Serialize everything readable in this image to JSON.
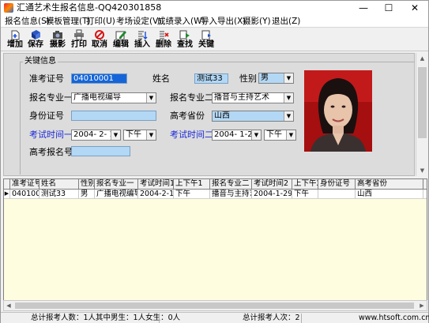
{
  "window": {
    "title": "汇通艺术生报名信息-QQ420301858",
    "minimize": "—",
    "maximize": "☐",
    "close": "✕"
  },
  "menu": [
    "报名信息(S)",
    "模板管理(T)",
    "打印(U)",
    "考场设定(V)",
    "成绩录入(W)",
    "导入导出(X)",
    "摄影(Y)",
    "退出(Z)"
  ],
  "toolbar": [
    {
      "label": "增加",
      "icon": "add-icon"
    },
    {
      "label": "保存",
      "icon": "save-icon"
    },
    {
      "label": "摄影",
      "icon": "camera-icon"
    },
    {
      "label": "打印",
      "icon": "print-icon"
    },
    {
      "label": "取消",
      "icon": "cancel-icon"
    },
    {
      "label": "编辑",
      "icon": "edit-icon"
    },
    {
      "label": "插入",
      "icon": "insert-icon"
    },
    {
      "label": "删除",
      "icon": "delete-icon"
    },
    {
      "label": "查找",
      "icon": "find-icon"
    },
    {
      "label": "关键",
      "icon": "close-doc-icon"
    }
  ],
  "form": {
    "group_title": "关键信息",
    "exam_no_label": "准考证号",
    "exam_no": "04010001",
    "name_label": "姓名",
    "name": "测试33",
    "gender_label": "性别",
    "gender": "男",
    "major1_label": "报名专业一",
    "major1": "广播电视编导",
    "major2_label": "报名专业二",
    "major2": "播音与主持艺术",
    "id_label": "身份证号",
    "id_no": "",
    "province_label": "高考省份",
    "province": "山西",
    "time1_label": "考试时间一",
    "date1": "2004- 2- 1",
    "ampm1": "下午",
    "time2_label": "考试时间二",
    "date2": "2004- 1-29",
    "ampm2": "下午",
    "gaokao_no_label": "高考报名号",
    "gaokao_no": ""
  },
  "grid": {
    "columns": [
      "准考证号",
      "姓名",
      "性别",
      "报名专业一",
      "考试时间1",
      "上下午1",
      "报名专业二",
      "考试时间2",
      "上下午2",
      "身份证号",
      "高考省份"
    ],
    "rows": [
      [
        "04010001",
        "测试33",
        "男",
        "广播电视编导",
        "2004-2-1",
        "下午",
        "播音与主持艺",
        "2004-1-29",
        "下午",
        "",
        "山西"
      ]
    ]
  },
  "status": {
    "count_text": "总计报考人数：1人其中男生：1人女生：0人",
    "total_text": "总计报考人次：2",
    "website": "www.htsoft.com.cn"
  },
  "colors": {
    "field_bg": "#b3d8f5",
    "selected_bg": "#1565d8",
    "label_blue": "#1a28d8",
    "grid_bg": "#fffde0"
  }
}
